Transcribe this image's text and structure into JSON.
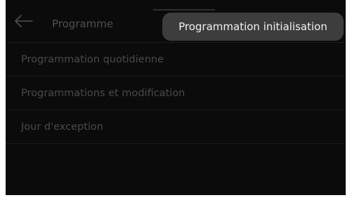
{
  "header": {
    "title": "Programme",
    "back_icon": "arrow-left-icon"
  },
  "menu": {
    "items": [
      {
        "label": "Programmation quotidienne"
      },
      {
        "label": "Programmations et modification"
      },
      {
        "label": "Jour d'exception"
      }
    ]
  },
  "tooltip": {
    "text": "Programmation initialisation"
  },
  "colors": {
    "background": "#0b0b0b",
    "dimmed_text": "#4a4a4a",
    "tooltip_bg": "#3d3d3d",
    "tooltip_text": "#f2f2f2"
  }
}
